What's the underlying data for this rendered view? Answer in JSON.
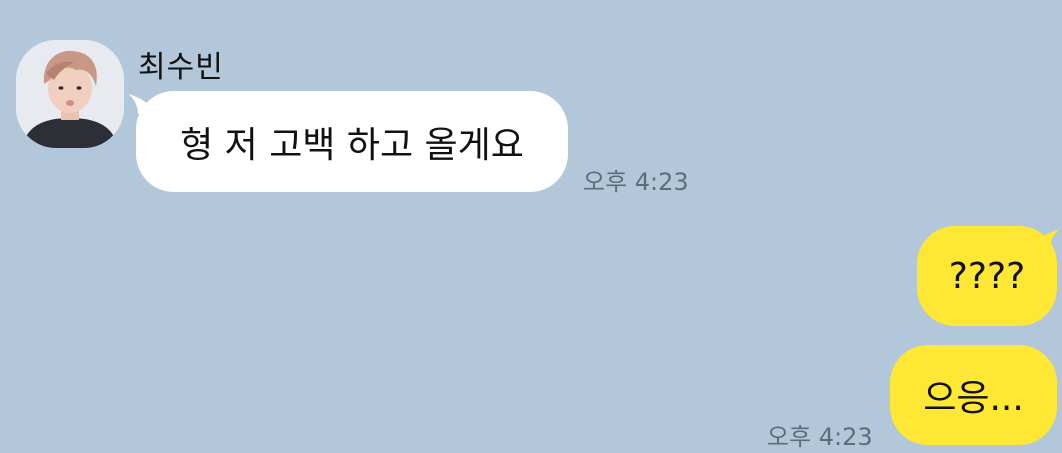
{
  "chat": {
    "sender": {
      "name": "최수빈",
      "avatar_icon": "profile-photo"
    },
    "messages": [
      {
        "direction": "incoming",
        "text": "형 저 고백 하고 올게요",
        "time": "오후 4:23"
      },
      {
        "direction": "outgoing",
        "text": "????"
      },
      {
        "direction": "outgoing",
        "text": "으응...",
        "time": "오후 4:23"
      }
    ]
  },
  "colors": {
    "background": "#b2c7d9",
    "incoming_bubble": "#ffffff",
    "outgoing_bubble": "#fee835",
    "timestamp": "#5f6d7a"
  }
}
